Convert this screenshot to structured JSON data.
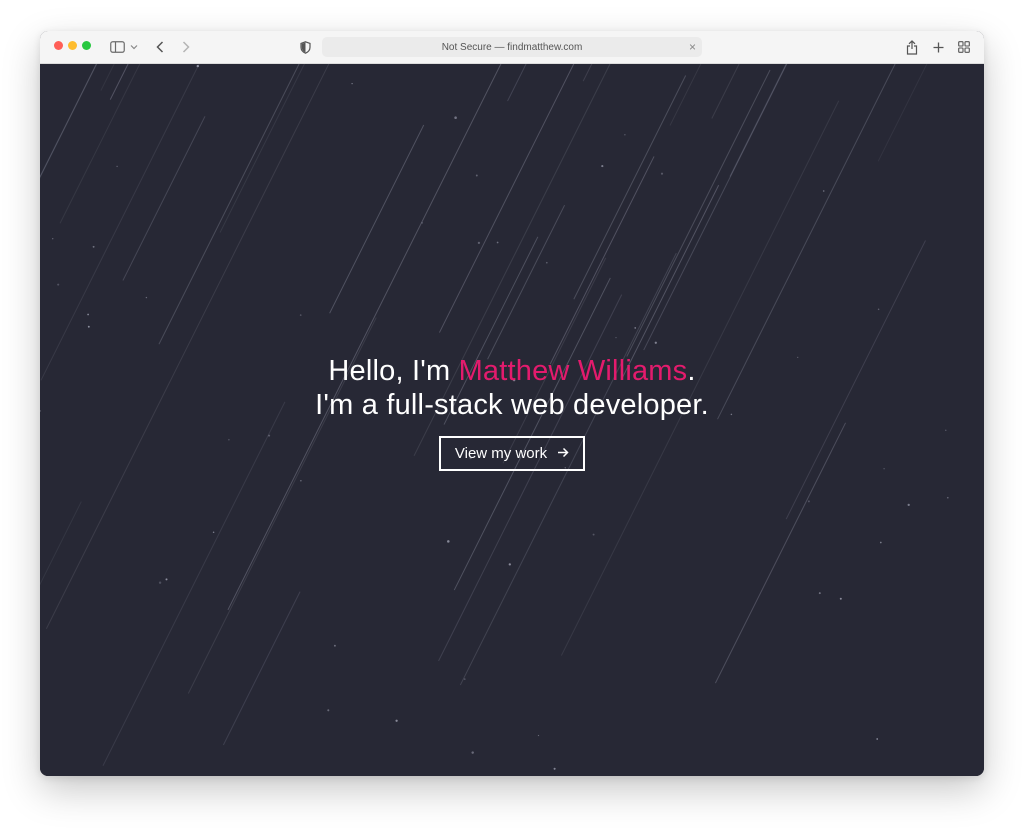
{
  "browser": {
    "address_text": "Not Secure — findmatthew.com",
    "icons": [
      "sidebar-icon",
      "chevron-down-icon",
      "back-icon",
      "forward-icon",
      "shield-icon",
      "close-icon",
      "share-icon",
      "plus-icon",
      "tabs-grid-icon"
    ]
  },
  "hero": {
    "greeting": "Hello, I'm ",
    "name": "Matthew Williams",
    "period": ".",
    "subtitle": "I'm a full-stack web developer.",
    "cta_label": "View my work",
    "cta_icon": "arrow-right-icon"
  },
  "colors": {
    "background": "#272835",
    "accent": "#e31b6d",
    "text": "#ffffff"
  }
}
